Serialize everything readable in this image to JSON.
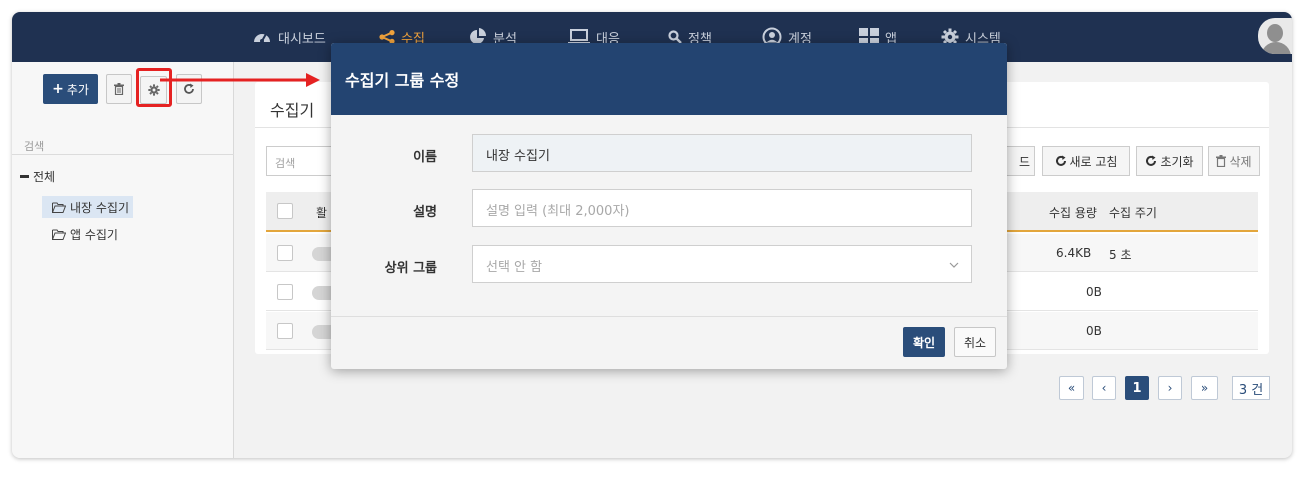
{
  "nav": {
    "items": [
      {
        "label": "대시보드",
        "icon": "dashboard-icon"
      },
      {
        "label": "수집",
        "icon": "share-icon",
        "active": true
      },
      {
        "label": "분석",
        "icon": "pie-chart-icon"
      },
      {
        "label": "대응",
        "icon": "laptop-icon"
      },
      {
        "label": "정책",
        "icon": "search-icon"
      },
      {
        "label": "계정",
        "icon": "user-circle-icon"
      },
      {
        "label": "앱",
        "icon": "grid-icon"
      },
      {
        "label": "시스템",
        "icon": "gear-icon"
      }
    ],
    "active_color": "#f0a23c"
  },
  "sidebar": {
    "add_label": "추가",
    "search_placeholder": "검색",
    "tree_root": "전체",
    "tree_items": [
      "내장 수집기",
      "앱 수집기"
    ]
  },
  "content": {
    "title": "수집기",
    "search_placeholder": "검색",
    "buttons": {
      "partial_label": "드",
      "refresh": "새로 고침",
      "reset": "초기화",
      "delete": "삭제"
    },
    "headers": {
      "first": "활",
      "size": "수집 용량",
      "interval": "수집 주기"
    },
    "rows": [
      {
        "size": "6.4KB",
        "interval": "5 초"
      },
      {
        "size": "0B",
        "interval": ""
      },
      {
        "size": "0B",
        "interval": ""
      }
    ]
  },
  "pager": {
    "first": "«",
    "prev": "‹",
    "current": "1",
    "next": "›",
    "last": "»",
    "total": "3 건"
  },
  "modal": {
    "title": "수집기 그룹 수정",
    "name_label": "이름",
    "name_value": "내장 수집기",
    "desc_label": "설명",
    "desc_placeholder": "설명 입력 (최대 2,000자)",
    "parent_label": "상위 그룹",
    "parent_value": "선택 안 함",
    "ok": "확인",
    "cancel": "취소"
  },
  "colors": {
    "header": "#1f3151",
    "modal_header": "#234471",
    "primary": "#2a4d7a",
    "highlight": "#e52222"
  }
}
